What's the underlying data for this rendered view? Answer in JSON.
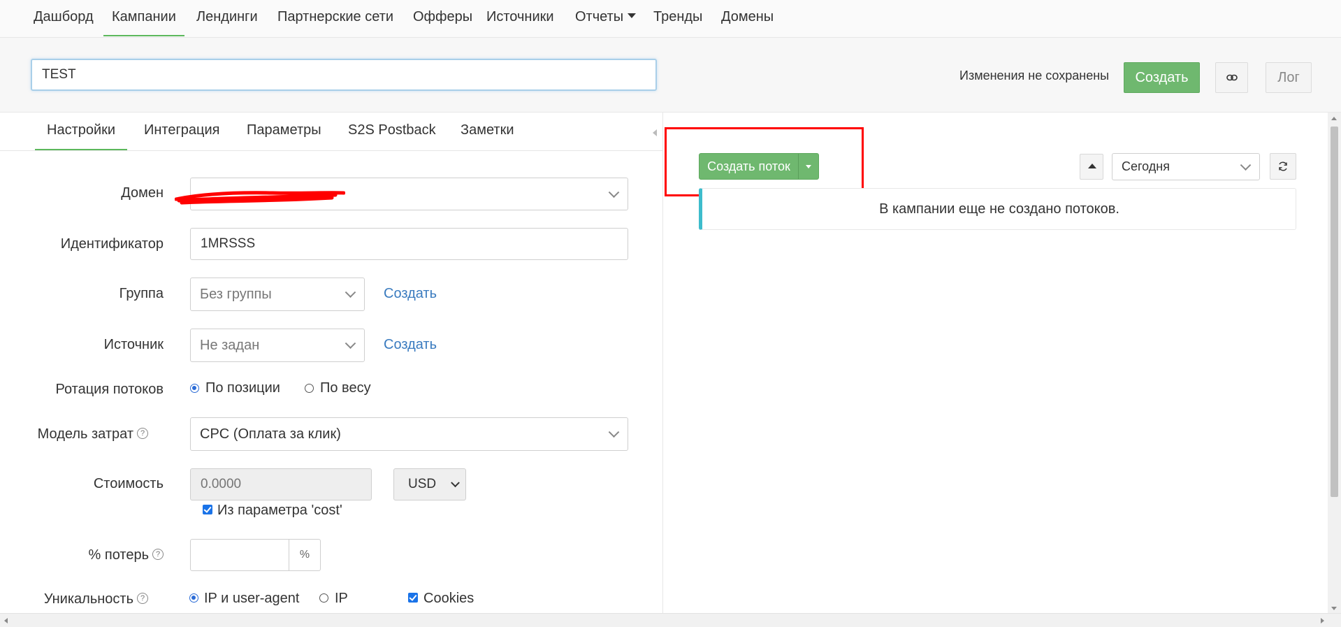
{
  "nav": {
    "items": [
      {
        "label": "Дашборд"
      },
      {
        "label": "Кампании"
      },
      {
        "label": "Лендинги"
      },
      {
        "label": "Партнерские сети"
      },
      {
        "label": "Офферы"
      },
      {
        "label": "Источники"
      },
      {
        "label": "Отчеты"
      },
      {
        "label": "Тренды"
      },
      {
        "label": "Домены"
      }
    ],
    "active": "Кампании"
  },
  "header": {
    "campaign_name": "TEST",
    "unsaved_text": "Изменения не сохранены",
    "create_label": "Создать",
    "link_icon": "link-icon",
    "log_label": "Лог"
  },
  "tabs": {
    "items": [
      {
        "label": "Настройки"
      },
      {
        "label": "Интеграция"
      },
      {
        "label": "Параметры"
      },
      {
        "label": "S2S Postback"
      },
      {
        "label": "Заметки"
      }
    ],
    "active": "Настройки"
  },
  "form": {
    "domain": {
      "label": "Домен",
      "value": ""
    },
    "identifier": {
      "label": "Идентификатор",
      "value": "1MRSSS"
    },
    "group": {
      "label": "Группа",
      "value": "Без группы",
      "create_link": "Создать"
    },
    "source": {
      "label": "Источник",
      "value": "Не задан",
      "create_link": "Создать"
    },
    "rotation": {
      "label": "Ротация потоков",
      "options": [
        "По позиции",
        "По весу"
      ],
      "selected": "По позиции"
    },
    "cost_model": {
      "label": "Модель затрат",
      "value": "CPC (Оплата за клик)"
    },
    "cost": {
      "label": "Стоимость",
      "placeholder": "0.0000",
      "currency": "USD",
      "from_param_label": "Из параметра 'cost'",
      "from_param_checked": true
    },
    "loss": {
      "label": "% потерь",
      "value": "",
      "suffix": "%"
    },
    "uniqueness": {
      "label": "Уникальность",
      "options": [
        "IP и user-agent",
        "IP"
      ],
      "selected": "IP и user-agent",
      "cookies_label": "Cookies",
      "cookies_checked": true
    }
  },
  "flows": {
    "create_flow_label": "Создать поток",
    "period": "Сегодня",
    "empty_message": "В кампании еще не создано потоков."
  },
  "colors": {
    "primary_green": "#6fb86f",
    "active_tab_underline": "#5cb85c",
    "link_blue": "#3a7bbf",
    "info_accent": "#3dbccc",
    "highlight_red": "#ff0000"
  }
}
